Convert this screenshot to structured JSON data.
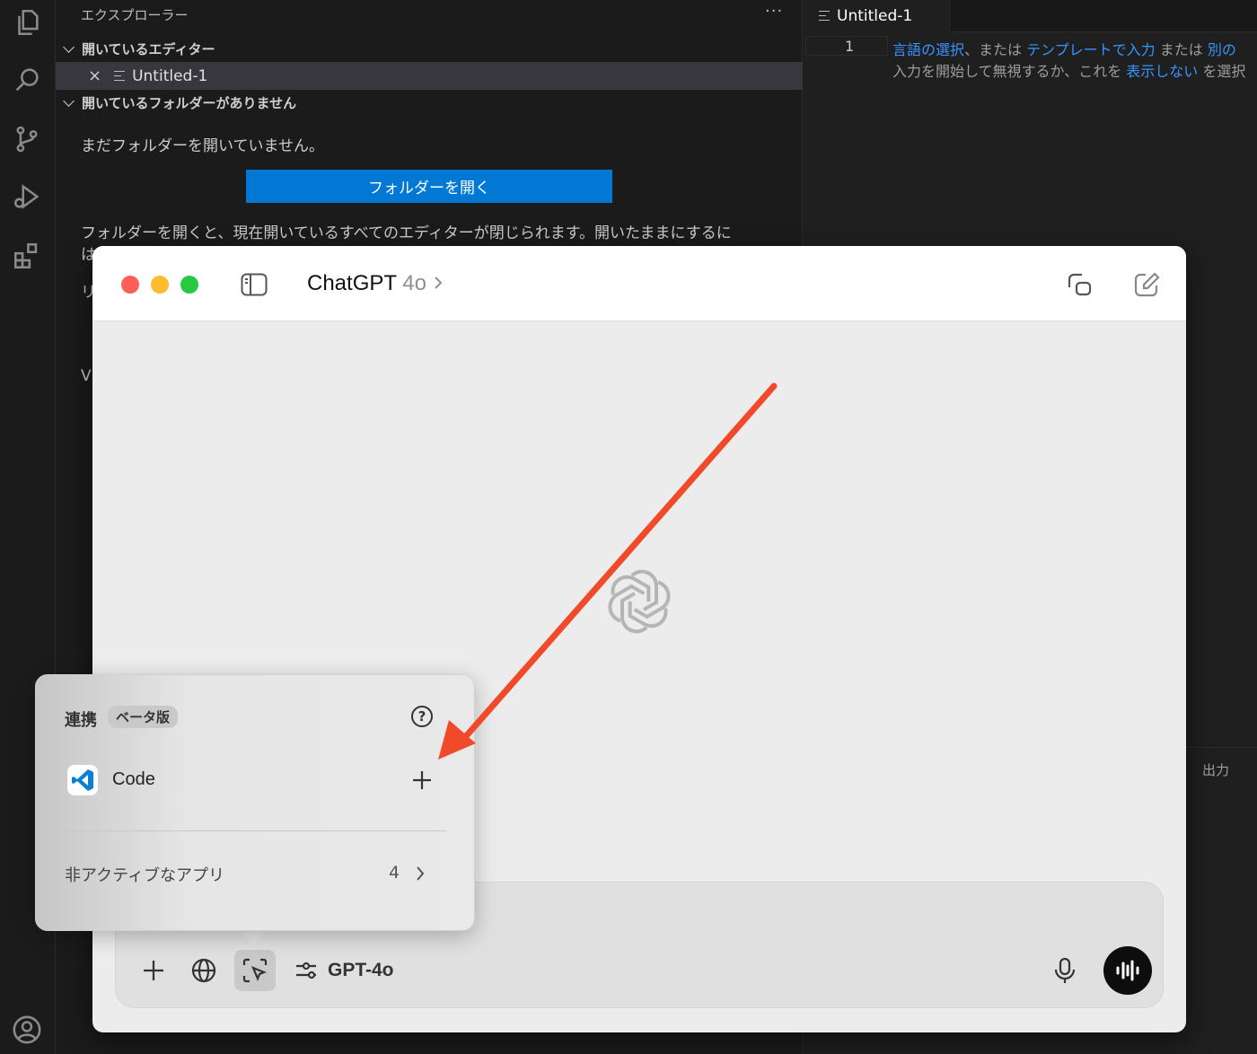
{
  "vscode": {
    "explorer": {
      "title": "エクスプローラー",
      "more": "···",
      "open_editors_header": "開いているエディター",
      "open_editor_file": "Untitled-1",
      "close_glyph": "×",
      "no_folder_header": "開いているフォルダーがありません",
      "no_folder_text": "まだフォルダーを開いていません。",
      "open_folder_button": "フォルダーを開く",
      "note_line1": "フォルダーを開くと、現在開いているすべてのエディターが閉じられます。開いたままにするに",
      "note_line2": "は",
      "note_line3": "リ",
      "note_line4": "V"
    },
    "editor": {
      "tab_label": "Untitled-1",
      "line_number": "1",
      "hint1_link1": "言語の選択",
      "hint1_t1": "、または ",
      "hint1_link2": "テンプレートで入力",
      "hint1_t2": " または ",
      "hint1_link3": "別の",
      "hint2_t1": "入力を開始して無視するか、これを ",
      "hint2_link": "表示しない",
      "hint2_t2": " を選択"
    },
    "panel": {
      "output_label": "出力"
    }
  },
  "chatgpt": {
    "title": "ChatGPT",
    "version": "4o",
    "model_label": "GPT-4o",
    "popover": {
      "title": "連携",
      "badge": "ベータ版",
      "help": "?",
      "app_name": "Code",
      "inactive_label": "非アクティブなアプリ",
      "inactive_count": "4"
    }
  },
  "colors": {
    "vscode_accent": "#0078d4",
    "link": "#3794ff",
    "traffic_red": "#ff5f57",
    "traffic_yellow": "#febc2e",
    "traffic_green": "#28c840",
    "arrow": "#f04a2a"
  }
}
